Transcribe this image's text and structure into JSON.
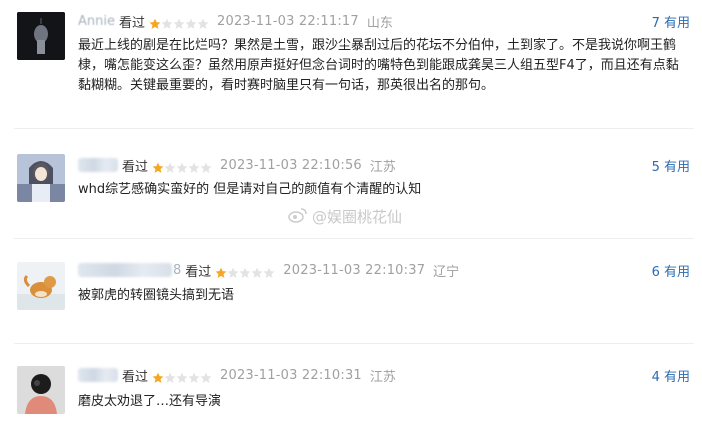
{
  "comments": [
    {
      "user": "Annie",
      "action": "看过",
      "rating": 1,
      "time": "2023-11-03 22:11:17",
      "location": "山东",
      "useful_count": "7",
      "useful_label": "有用",
      "content": "最近上线的剧是在比烂吗？果然是土雪，跟沙尘暴刮过后的花坛不分伯仲，土到家了。不是我说你啊王鹤棣，嘴怎能变这么歪？虽然用原声挺好但念台词时的嘴特色到能跟成龚昊三人组五型F4了，而且还有点黏黏糊糊。关键最重要的，看时赛时脑里只有一句话，那英很出名的那句。"
    },
    {
      "user": "",
      "action": "看过",
      "rating": 1,
      "time": "2023-11-03 22:10:56",
      "location": "江苏",
      "useful_count": "5",
      "useful_label": "有用",
      "content": "whd综艺感确实蛮好的 但是请对自己的颜值有个清醒的认知"
    },
    {
      "user": "8",
      "action": "看过",
      "rating": 1,
      "time": "2023-11-03 22:10:37",
      "location": "辽宁",
      "useful_count": "6",
      "useful_label": "有用",
      "content": "被郭虎的转圈镜头搞到无语"
    },
    {
      "user": "",
      "action": "看过",
      "rating": 1,
      "time": "2023-11-03 22:10:31",
      "location": "江苏",
      "useful_count": "4",
      "useful_label": "有用",
      "content": "磨皮太劝退了…还有导演"
    }
  ],
  "watermark": {
    "text": "@娱圈桃花仙"
  },
  "colors": {
    "star_on": "#f5a623",
    "star_off": "#e3e3e3",
    "link": "#2b6cb0"
  }
}
